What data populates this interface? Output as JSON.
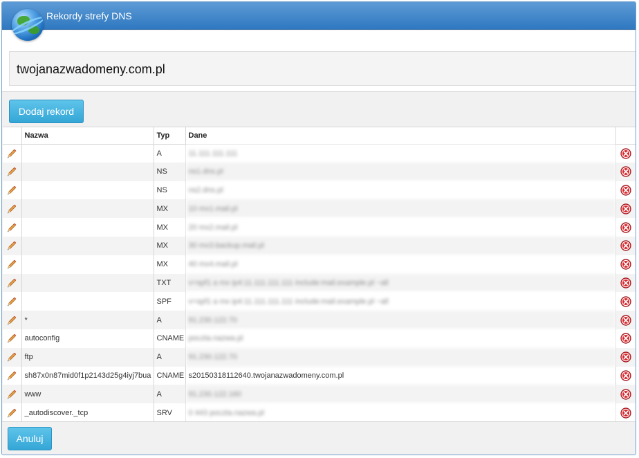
{
  "window": {
    "title": "Rekordy strefy DNS"
  },
  "domain": "twojanazwadomeny.com.pl",
  "buttons": {
    "add": "Dodaj rekord",
    "cancel": "Anuluj"
  },
  "table": {
    "headers": {
      "name": "Nazwa",
      "type": "Typ",
      "data": "Dane"
    },
    "rows": [
      {
        "name": "",
        "type": "A",
        "data": "11.111.111.111",
        "blurred": true
      },
      {
        "name": "",
        "type": "NS",
        "data": "ns1.dns.pl",
        "blurred": true
      },
      {
        "name": "",
        "type": "NS",
        "data": "ns2.dns.pl",
        "blurred": true
      },
      {
        "name": "",
        "type": "MX",
        "data": "10 mx1.mail.pl",
        "blurred": true
      },
      {
        "name": "",
        "type": "MX",
        "data": "20 mx2.mail.pl",
        "blurred": true
      },
      {
        "name": "",
        "type": "MX",
        "data": "30 mx3.backup.mail.pl",
        "blurred": true
      },
      {
        "name": "",
        "type": "MX",
        "data": "40 mx4.mail.pl",
        "blurred": true
      },
      {
        "name": "",
        "type": "TXT",
        "data": "v=spf1 a mx ip4:11.111.111.111 include:mail.example.pl ~all",
        "blurred": true
      },
      {
        "name": "",
        "type": "SPF",
        "data": "v=spf1 a mx ip4:11.111.111.111 include:mail.example.pl ~all",
        "blurred": true
      },
      {
        "name": "*",
        "type": "A",
        "data": "91.230.122.70",
        "blurred": true
      },
      {
        "name": "autoconfig",
        "type": "CNAME",
        "data": "poczta.nazwa.pl",
        "blurred": true
      },
      {
        "name": "ftp",
        "type": "A",
        "data": "91.230.122.70",
        "blurred": true
      },
      {
        "name": "sh87x0n87mid0f1p2143d25g4iyj7bua",
        "type": "CNAME",
        "data": "s20150318112640.twojanazwadomeny.com.pl",
        "blurred": false
      },
      {
        "name": "www",
        "type": "A",
        "data": "91.230.122.160",
        "blurred": true
      },
      {
        "name": "_autodiscover._tcp",
        "type": "SRV",
        "data": "0 443 poczta.nazwa.pl",
        "blurred": true
      }
    ]
  },
  "colors": {
    "titlebar": "#3b85cc",
    "button": "#45b3e0",
    "delete": "#d8262c",
    "pencil": "#e07a2a"
  }
}
